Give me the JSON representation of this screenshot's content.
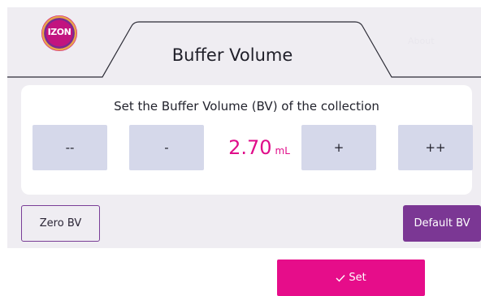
{
  "app": {
    "logo_text": "IZON",
    "colors": {
      "accent": "#e60d8a",
      "brand_purple": "#7b3794",
      "stepper": "#d5d8ea",
      "panel": "#efedf2"
    }
  },
  "tabs": {
    "active_label": "Buffer Volume",
    "faint_label": "About"
  },
  "buffer_volume": {
    "heading": "Set the Buffer Volume (BV) of the collection",
    "value": "2.70",
    "unit": "mL",
    "buttons": {
      "decrement_large": "--",
      "decrement": "-",
      "increment": "+",
      "increment_large": "++"
    }
  },
  "actions": {
    "zero_label": "Zero BV",
    "default_label": "Default BV",
    "set_label": "Set",
    "set_icon": "check-icon"
  }
}
